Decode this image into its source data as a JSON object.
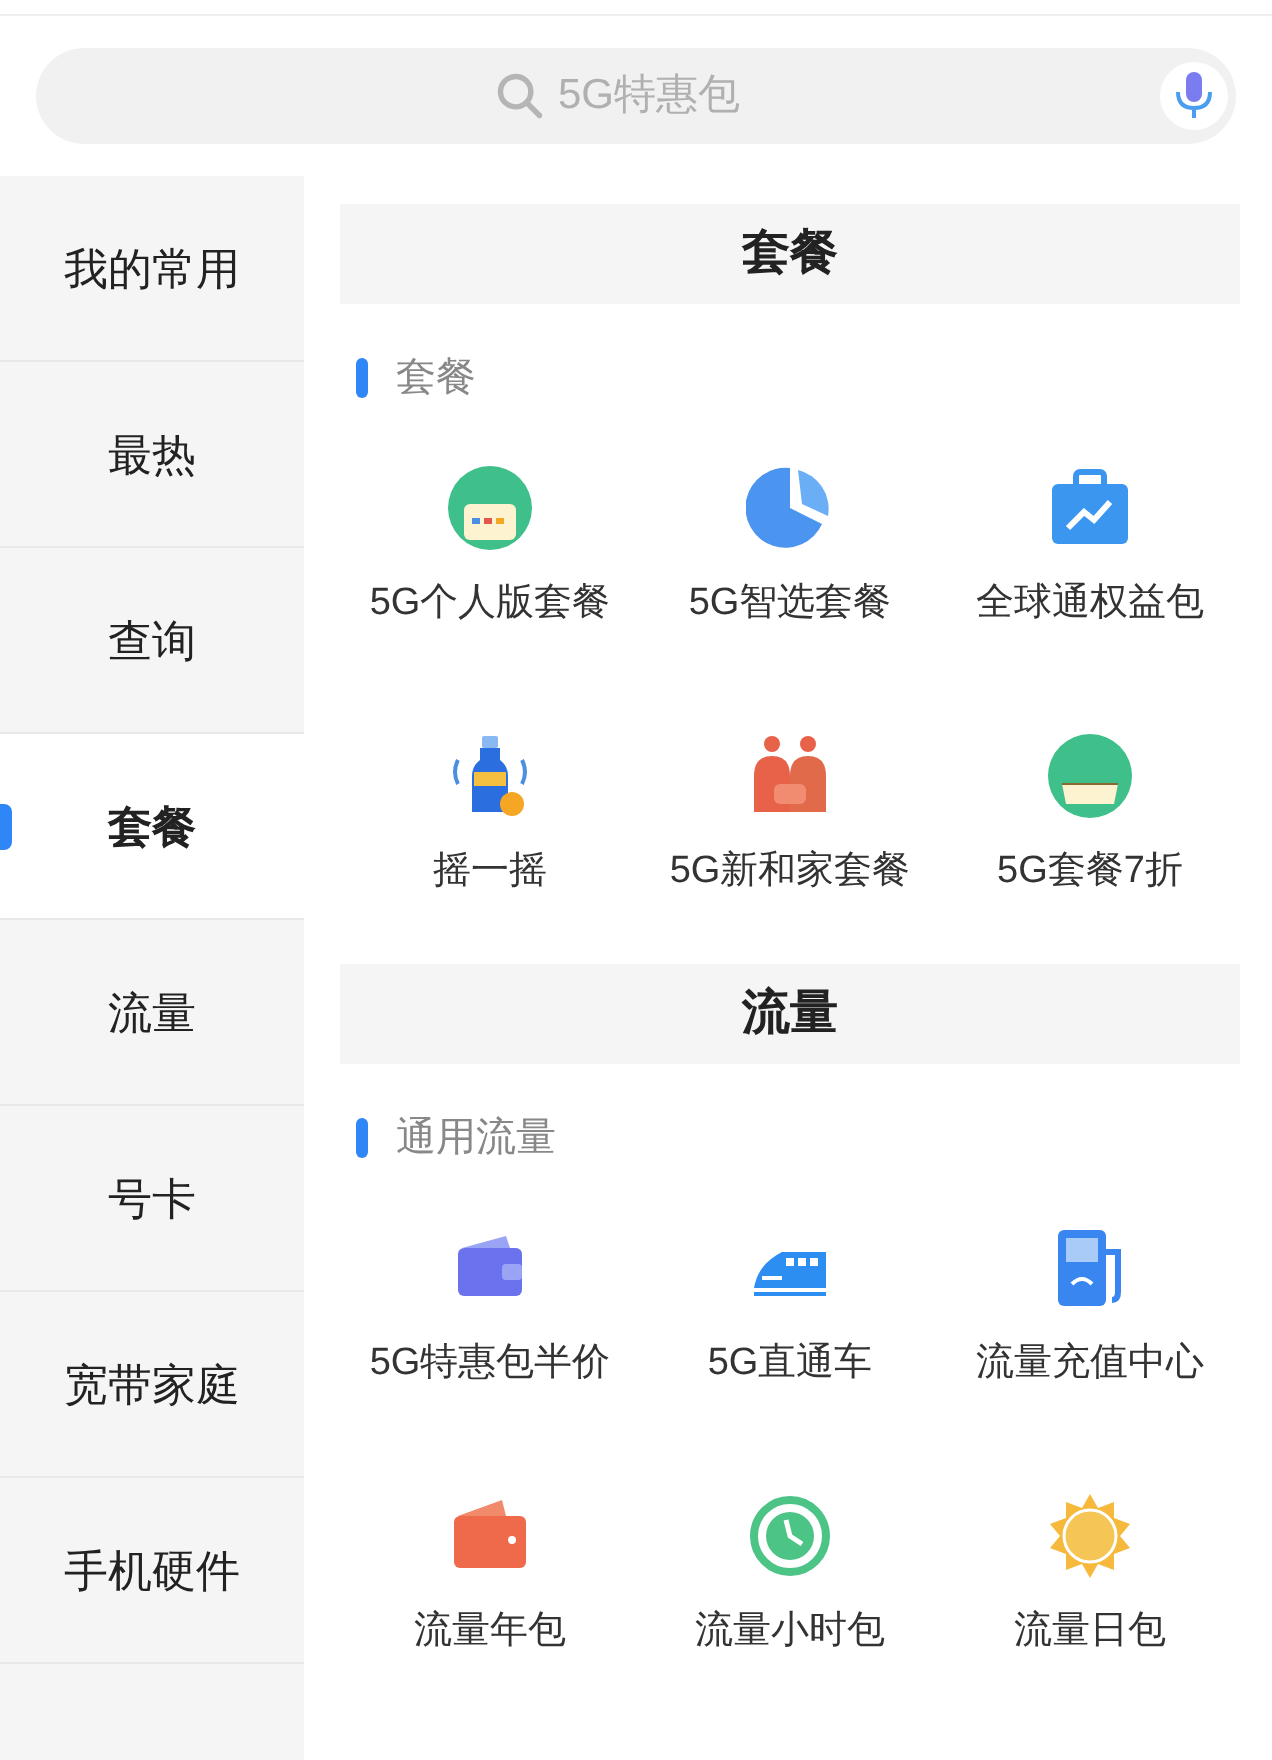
{
  "search": {
    "placeholder": "5G特惠包"
  },
  "sidebar": {
    "items": [
      {
        "label": "我的常用",
        "selected": false
      },
      {
        "label": "最热",
        "selected": false
      },
      {
        "label": "查询",
        "selected": false
      },
      {
        "label": "套餐",
        "selected": true
      },
      {
        "label": "流量",
        "selected": false
      },
      {
        "label": "号卡",
        "selected": false
      },
      {
        "label": "宽带家庭",
        "selected": false
      },
      {
        "label": "手机硬件",
        "selected": false
      }
    ]
  },
  "sections": [
    {
      "title": "套餐",
      "groups": [
        {
          "title": "套餐",
          "items": [
            {
              "label": "5G个人版套餐",
              "kind": "badge"
            },
            {
              "label": "5G智选套餐",
              "kind": "pie"
            },
            {
              "label": "全球通权益包",
              "kind": "briefcase"
            },
            {
              "label": "摇一摇",
              "kind": "bottle"
            },
            {
              "label": "5G新和家套餐",
              "kind": "family"
            },
            {
              "label": "5G套餐7折",
              "kind": "medal"
            }
          ]
        }
      ]
    },
    {
      "title": "流量",
      "groups": [
        {
          "title": "通用流量",
          "items": [
            {
              "label": "5G特惠包半价",
              "kind": "wallet"
            },
            {
              "label": "5G直通车",
              "kind": "train"
            },
            {
              "label": "流量充值中心",
              "kind": "pump"
            },
            {
              "label": "流量年包",
              "kind": "purse"
            },
            {
              "label": "流量小时包",
              "kind": "clock"
            },
            {
              "label": "流量日包",
              "kind": "sun"
            }
          ]
        }
      ]
    }
  ]
}
